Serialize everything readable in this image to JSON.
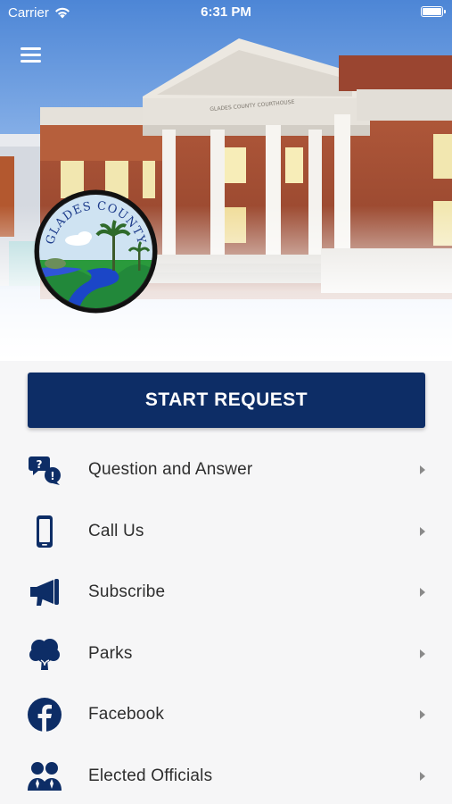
{
  "status_bar": {
    "carrier": "Carrier",
    "time": "6:31 PM"
  },
  "hero": {
    "building_sign": "GLADES COUNTY COURTHOUSE",
    "seal_text": "GLADES COUNTY"
  },
  "start_request": {
    "label": "START REQUEST"
  },
  "menu": {
    "items": [
      {
        "label": "Question and Answer",
        "icon": "question-bubbles-icon"
      },
      {
        "label": "Call Us",
        "icon": "phone-icon"
      },
      {
        "label": "Subscribe",
        "icon": "megaphone-icon"
      },
      {
        "label": "Parks",
        "icon": "tree-icon"
      },
      {
        "label": "Facebook",
        "icon": "facebook-icon"
      },
      {
        "label": "Elected Officials",
        "icon": "officials-icon"
      }
    ]
  },
  "colors": {
    "primary": "#0d2d66",
    "text": "#2e2e2e",
    "background": "#f6f6f7"
  }
}
